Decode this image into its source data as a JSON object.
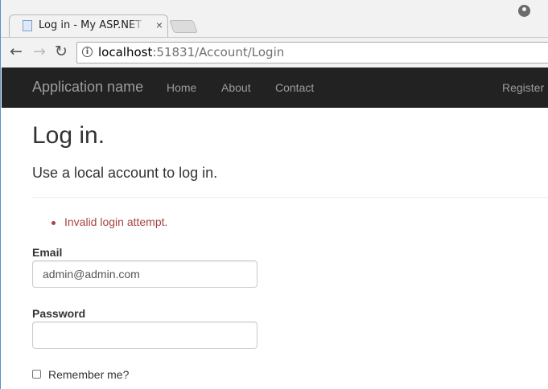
{
  "browser": {
    "tab_title": "Log in - My ASP.NET Application",
    "tab_close": "×",
    "url_host": "localhost",
    "url_rest": ":51831/Account/Login",
    "back_glyph": "←",
    "forward_glyph": "→",
    "reload_glyph": "↻",
    "info_glyph": "i"
  },
  "navbar": {
    "brand": "Application name",
    "links": [
      "Home",
      "About",
      "Contact"
    ],
    "right_link": "Register"
  },
  "page": {
    "title": "Log in.",
    "subtitle": "Use a local account to log in.",
    "errors": [
      "Invalid login attempt."
    ]
  },
  "form": {
    "email_label": "Email",
    "email_value": "admin@admin.com",
    "password_label": "Password",
    "password_value": "",
    "remember_label": "Remember me?"
  },
  "colors": {
    "navbar_bg": "#222222",
    "navbar_text": "#9d9d9d",
    "error": "#a94442"
  },
  "icons": {
    "favicon": "page-icon",
    "profile": "user-circle-icon",
    "info": "info-icon"
  }
}
